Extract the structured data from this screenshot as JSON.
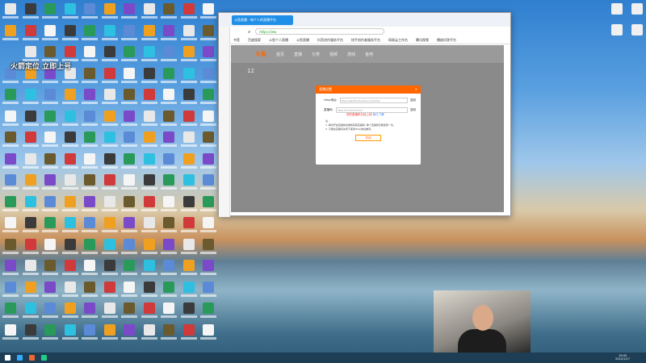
{
  "overlay_caption": "火箭定位 立即上号",
  "browser": {
    "tab_title": "斗鱼直播 - 每个人的直播平台",
    "url": "https://ww",
    "bookmarks": [
      "书签",
      "百度搜索",
      "斗鱼个人直播",
      "斗鱼直播",
      "抖音创作服务平台",
      "快手创作者服务平台",
      "网易云工作台",
      "腾讯视频",
      "播放问答平台"
    ],
    "nav": {
      "logo": "斗鱼",
      "items": [
        "首页",
        "直播",
        "分类",
        "视频",
        "游戏",
        "鱼吧"
      ],
      "search_placeholder": "搜索"
    },
    "stats_value": "12"
  },
  "dialog": {
    "title": "直播设置",
    "rtmp_label": "rtmp地址:",
    "rtmp_value": "rtmp://sendtc3a.douyu.com/live",
    "code_label": "直播码:",
    "code_value": "7921???????????????",
    "copy_label": "复制",
    "warning": "您的直播码已经上线",
    "help_link": "我已了解",
    "note_title": "注:",
    "notes": [
      "1. 每次开启直播前请重新获取直播码, 每个直播码仅能使用一次。",
      "2. 只能在直播间关闭下使用rtmp地址推流。"
    ],
    "close_button": "关闭"
  },
  "taskbar": {
    "time": "19:40",
    "date": "2022/1/17"
  }
}
